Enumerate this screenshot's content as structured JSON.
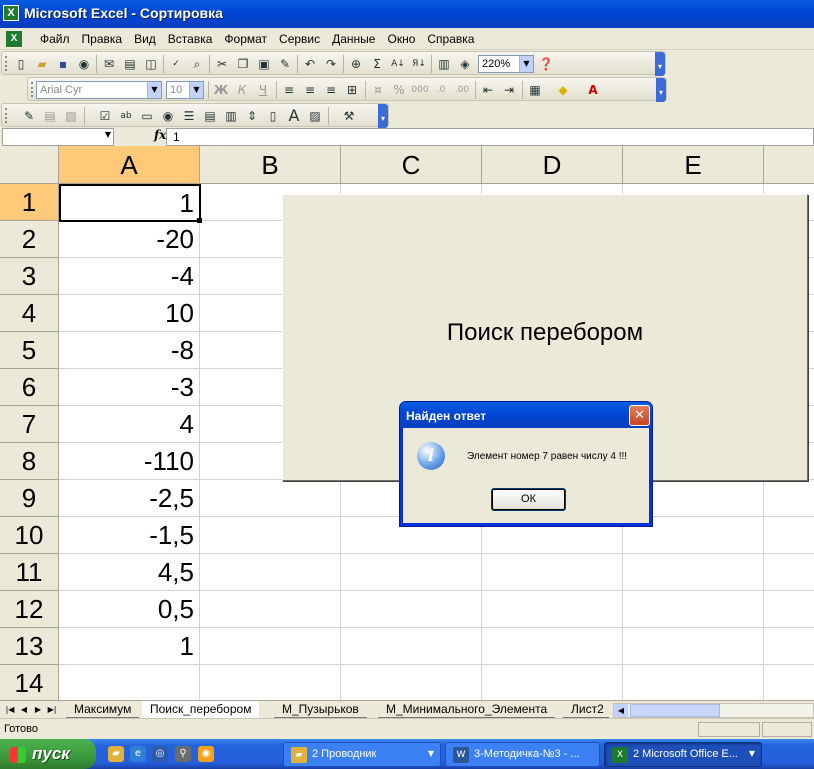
{
  "window": {
    "app_icon": "excel-icon",
    "title": "Microsoft Excel - Сортировка"
  },
  "menu": [
    "Файл",
    "Правка",
    "Вид",
    "Вставка",
    "Формат",
    "Сервис",
    "Данные",
    "Окно",
    "Справка"
  ],
  "toolbar_standard": {
    "zoom": "220%"
  },
  "toolbar_formatting": {
    "font_name": "Arial Cyr",
    "font_size": "10",
    "bold": "Ж",
    "italic": "К",
    "underline": "Ч"
  },
  "formula_bar": {
    "name_box": "",
    "fx": "fx",
    "value": "1"
  },
  "grid": {
    "columns": [
      "A",
      "B",
      "C",
      "D",
      "E"
    ],
    "rows": [
      "1",
      "2",
      "3",
      "4",
      "5",
      "6",
      "7",
      "8",
      "9",
      "10",
      "11",
      "12",
      "13",
      "14"
    ],
    "column_a_values": [
      "1",
      "-20",
      "-4",
      "10",
      "-8",
      "-3",
      "4",
      "-110",
      "-2,5",
      "-1,5",
      "4,5",
      "0,5",
      "1",
      ""
    ],
    "selected_cell": "A1"
  },
  "embedded_button": {
    "label": "Поиск перебором"
  },
  "dialog": {
    "title": "Найден ответ",
    "close": "✕",
    "icon": "info-icon",
    "message": "Элемент номер 7 равен числу 4 !!!",
    "ok": "ОК"
  },
  "sheet_tabs": [
    "Максимум",
    "Поиск_перебором",
    "М_Пузырьков",
    "М_Минимального_Элемента",
    "Лист2"
  ],
  "active_sheet": "Поиск_перебором",
  "status": {
    "text": "Готово"
  },
  "taskbar": {
    "start": "пуск",
    "tasks": [
      {
        "label": "2 Проводник",
        "icon": "folder-icon"
      },
      {
        "label": "3-Методичка-№3 - ...",
        "icon": "word-icon"
      },
      {
        "label": "2 Microsoft Office E...",
        "icon": "excel-icon"
      }
    ]
  },
  "colors": {
    "titlebar": "#0046D5",
    "selected_header": "#FFC97A",
    "taskbar": "#245EDC",
    "start_button": "#3C9A3C"
  }
}
